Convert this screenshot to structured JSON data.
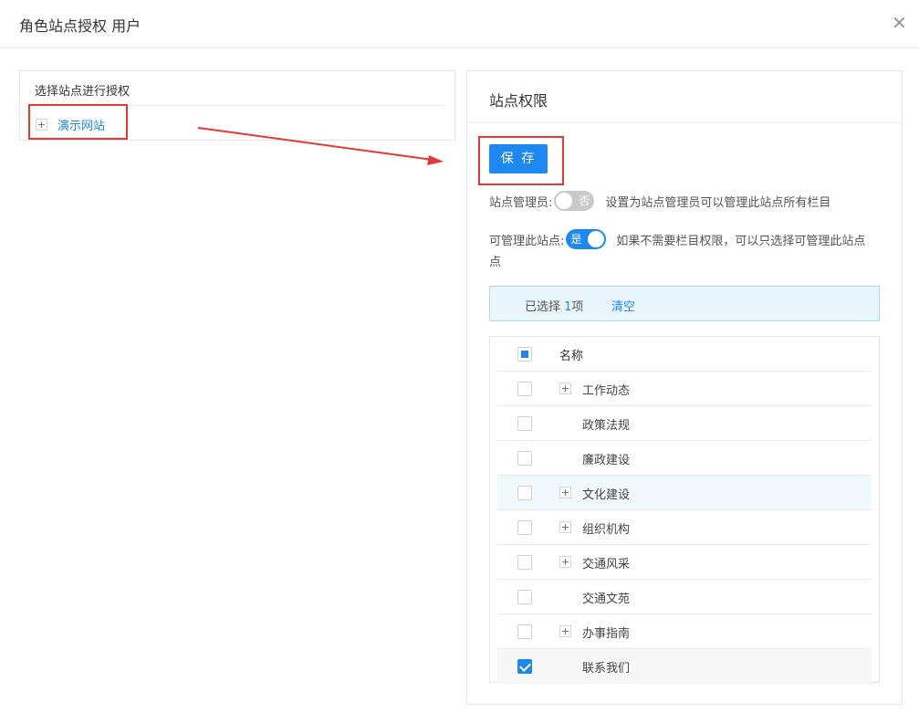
{
  "dialog": {
    "title": "角色站点授权 用户",
    "close_glyph": "✕"
  },
  "left_panel": {
    "title": "选择站点进行授权",
    "node_expander": "+",
    "site_label": "演示网站"
  },
  "right_panel": {
    "title": "站点权限",
    "save_label": "保 存",
    "site_admin": {
      "label": "站点管理员:",
      "toggle_text": "否",
      "checked": false,
      "description": "设置为站点管理员可以管理此站点所有栏目"
    },
    "can_manage": {
      "label": "可管理此站点:",
      "toggle_text": "是",
      "checked": true,
      "description_line1": "如果不需要栏目权限，可以只选择可管理此站点",
      "description_line2": "点"
    },
    "selection": {
      "prefix": "已选择 ",
      "count": "1",
      "suffix": "项",
      "clear_label": "清空"
    },
    "table": {
      "header": "名称",
      "rows": [
        {
          "label": "工作动态",
          "expandable": true,
          "checked": false
        },
        {
          "label": "政策法规",
          "expandable": false,
          "checked": false
        },
        {
          "label": "廉政建设",
          "expandable": false,
          "checked": false
        },
        {
          "label": "文化建设",
          "expandable": true,
          "checked": false
        },
        {
          "label": "组织机构",
          "expandable": true,
          "checked": false
        },
        {
          "label": "交通风采",
          "expandable": true,
          "checked": false
        },
        {
          "label": "交通文苑",
          "expandable": false,
          "checked": false
        },
        {
          "label": "办事指南",
          "expandable": true,
          "checked": false
        },
        {
          "label": "联系我们",
          "expandable": false,
          "checked": true
        }
      ]
    }
  },
  "colors": {
    "accent": "#1e87f0",
    "annotation": "#e53935"
  }
}
